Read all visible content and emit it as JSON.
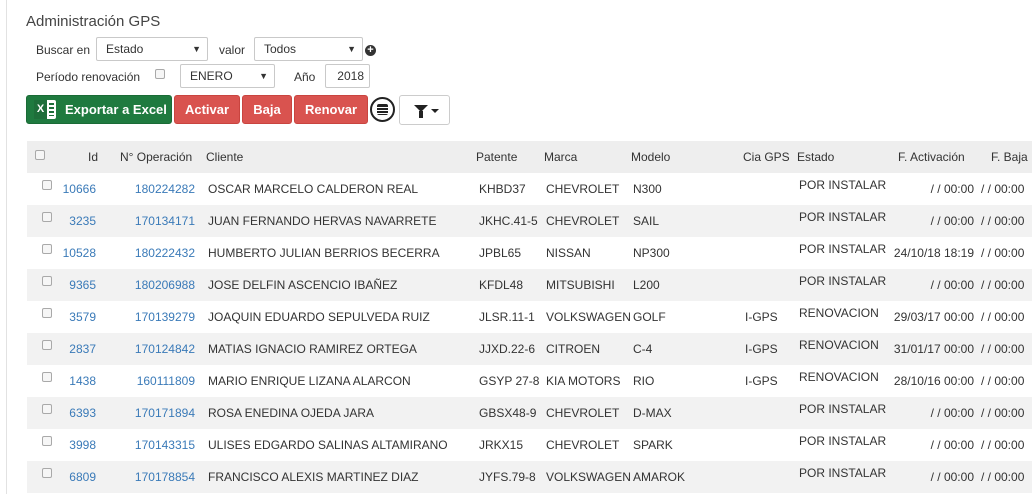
{
  "page": {
    "title": "Administración GPS"
  },
  "filters": {
    "search_in_label": "Buscar en",
    "search_in_value": "Estado",
    "value_label": "valor",
    "value_value": "Todos",
    "renewal_label": "Período renovación",
    "month_value": "ENERO",
    "year_label": "Año",
    "year_value": "2018"
  },
  "toolbar": {
    "export_label": "Exportar a Excel",
    "activate_label": "Activar",
    "deactivate_label": "Baja",
    "renew_label": "Renovar"
  },
  "table": {
    "headers": {
      "id": "Id",
      "operation": "N° Operación",
      "client": "Cliente",
      "plate": "Patente",
      "brand": "Marca",
      "model": "Modelo",
      "gps": "Cia GPS",
      "status": "Estado",
      "activation": "F. Activación",
      "deactivation": "F. Baja"
    },
    "rows": [
      {
        "id": "10666",
        "operation": "180224282",
        "client": "OSCAR MARCELO CALDERON REAL",
        "plate": "KHBD37",
        "brand": "CHEVROLET",
        "model": "N300",
        "gps": "",
        "status": "POR INSTALAR",
        "activation": " /  / 00:00",
        "deactivation": " /  / 00:00"
      },
      {
        "id": "3235",
        "operation": "170134171",
        "client": "JUAN FERNANDO HERVAS NAVARRETE",
        "plate": "JKHC.41-5",
        "brand": "CHEVROLET",
        "model": "SAIL",
        "gps": "",
        "status": "POR INSTALAR",
        "activation": " /  / 00:00",
        "deactivation": " /  / 00:00"
      },
      {
        "id": "10528",
        "operation": "180222432",
        "client": "HUMBERTO JULIAN BERRIOS BECERRA",
        "plate": "JPBL65",
        "brand": "NISSAN",
        "model": "NP300",
        "gps": "",
        "status": "POR INSTALAR",
        "activation": "24/10/18 18:19",
        "deactivation": " /  / 00:00"
      },
      {
        "id": "9365",
        "operation": "180206988",
        "client": "JOSE DELFIN ASCENCIO IBAÑEZ",
        "plate": "KFDL48",
        "brand": "MITSUBISHI",
        "model": "L200",
        "gps": "",
        "status": "POR INSTALAR",
        "activation": " /  / 00:00",
        "deactivation": " /  / 00:00"
      },
      {
        "id": "3579",
        "operation": "170139279",
        "client": "JOAQUIN EDUARDO SEPULVEDA RUIZ",
        "plate": "JLSR.11-1",
        "brand": "VOLKSWAGEN",
        "model": "GOLF",
        "gps": "I-GPS",
        "status": "RENOVACION",
        "activation": "29/03/17 00:00",
        "deactivation": " /  / 00:00"
      },
      {
        "id": "2837",
        "operation": "170124842",
        "client": "MATIAS IGNACIO RAMIREZ ORTEGA",
        "plate": "JJXD.22-6",
        "brand": "CITROEN",
        "model": "C-4",
        "gps": "I-GPS",
        "status": "RENOVACION",
        "activation": "31/01/17 00:00",
        "deactivation": " /  / 00:00"
      },
      {
        "id": "1438",
        "operation": "160111809",
        "client": "MARIO ENRIQUE LIZANA ALARCON",
        "plate": "GSYP 27-8",
        "brand": "KIA MOTORS",
        "model": "RIO",
        "gps": "I-GPS",
        "status": "RENOVACION",
        "activation": "28/10/16 00:00",
        "deactivation": " /  / 00:00"
      },
      {
        "id": "6393",
        "operation": "170171894",
        "client": "ROSA ENEDINA OJEDA JARA",
        "plate": "GBSX48-9",
        "brand": "CHEVROLET",
        "model": "D-MAX",
        "gps": "",
        "status": "POR INSTALAR",
        "activation": " /  / 00:00",
        "deactivation": " /  / 00:00"
      },
      {
        "id": "3998",
        "operation": "170143315",
        "client": "ULISES EDGARDO SALINAS ALTAMIRANO",
        "plate": "JRKX15",
        "brand": "CHEVROLET",
        "model": "SPARK",
        "gps": "",
        "status": "POR INSTALAR",
        "activation": " /  / 00:00",
        "deactivation": " /  / 00:00"
      },
      {
        "id": "6809",
        "operation": "170178854",
        "client": "FRANCISCO ALEXIS MARTINEZ DIAZ",
        "plate": "JYFS.79-8",
        "brand": "VOLKSWAGEN",
        "model": "AMAROK",
        "gps": "",
        "status": "POR INSTALAR",
        "activation": " /  / 00:00",
        "deactivation": " /  / 00:00"
      }
    ]
  },
  "icons": {
    "excel": "excel-icon",
    "add": "plus-circle-icon",
    "settings": "settings-circle-icon",
    "filter": "filter-icon"
  }
}
